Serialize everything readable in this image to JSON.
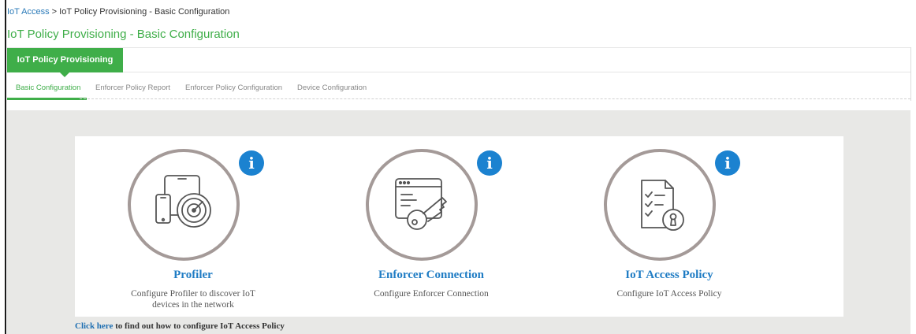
{
  "breadcrumb": {
    "root": "IoT Access",
    "separator": " > ",
    "current": "IoT Policy Provisioning - Basic Configuration"
  },
  "page_title": "IoT Policy Provisioning - Basic Configuration",
  "main_tab": {
    "label": "IoT Policy Provisioning",
    "active": true
  },
  "subtabs": [
    {
      "label": "Basic Configuration",
      "active": true
    },
    {
      "label": "Enforcer Policy Report",
      "active": false
    },
    {
      "label": "Enforcer Policy Configuration",
      "active": false
    },
    {
      "label": "Device Configuration",
      "active": false
    }
  ],
  "cards": [
    {
      "title": "Profiler",
      "description_lines": [
        "Configure Profiler to discover IoT",
        "devices in the network"
      ],
      "icon": "devices-radar-icon",
      "info_icon": "i"
    },
    {
      "title": "Enforcer Connection",
      "description_lines": [
        "Configure Enforcer Connection"
      ],
      "icon": "browser-key-icon",
      "info_icon": "i"
    },
    {
      "title": "IoT Access Policy",
      "description_lines": [
        "Configure IoT Access Policy"
      ],
      "icon": "checklist-lock-icon",
      "info_icon": "i"
    }
  ],
  "footer": {
    "link_text": "Click here",
    "rest_text": " to find out how to configure IoT Access Policy"
  },
  "colors": {
    "accent_green": "#3fae49",
    "link_blue": "#1f7cc4",
    "info_blue": "#1b82d0",
    "circle_border": "#a49a98",
    "background_grey": "#e8e8e6"
  }
}
